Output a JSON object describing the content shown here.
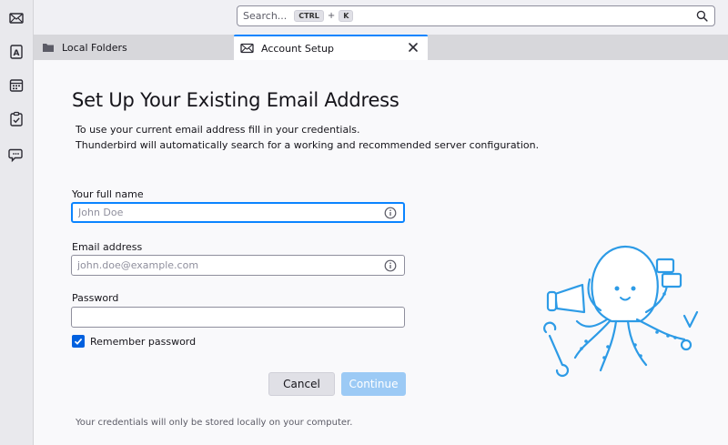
{
  "spaces": {
    "items": [
      {
        "name": "mail"
      },
      {
        "name": "address-book"
      },
      {
        "name": "calendar"
      },
      {
        "name": "tasks"
      },
      {
        "name": "chat"
      }
    ]
  },
  "search": {
    "placeholder": "Search...",
    "shortcut_key1": "CTRL",
    "shortcut_plus": "+",
    "shortcut_key2": "K"
  },
  "tabs": [
    {
      "label": "Local Folders",
      "icon": "folder-icon",
      "active": false
    },
    {
      "label": "Account Setup",
      "icon": "mail-icon",
      "active": true
    }
  ],
  "form": {
    "title": "Set Up Your Existing Email Address",
    "description_line1": "To use your current email address fill in your credentials.",
    "description_line2": "Thunderbird will automatically search for a working and recommended server configuration.",
    "fullname_label": "Your full name",
    "fullname_placeholder": "John Doe",
    "fullname_value": "",
    "email_label": "Email address",
    "email_placeholder": "john.doe@example.com",
    "email_value": "",
    "password_label": "Password",
    "password_value": "",
    "remember_label": "Remember password",
    "remember_checked": true,
    "cancel_label": "Cancel",
    "continue_label": "Continue",
    "note": "Your credentials will only be stored locally on your computer."
  },
  "colors": {
    "accent": "#0060df",
    "focus": "#0a84ff",
    "continue_disabled": "#9ccaf5"
  }
}
